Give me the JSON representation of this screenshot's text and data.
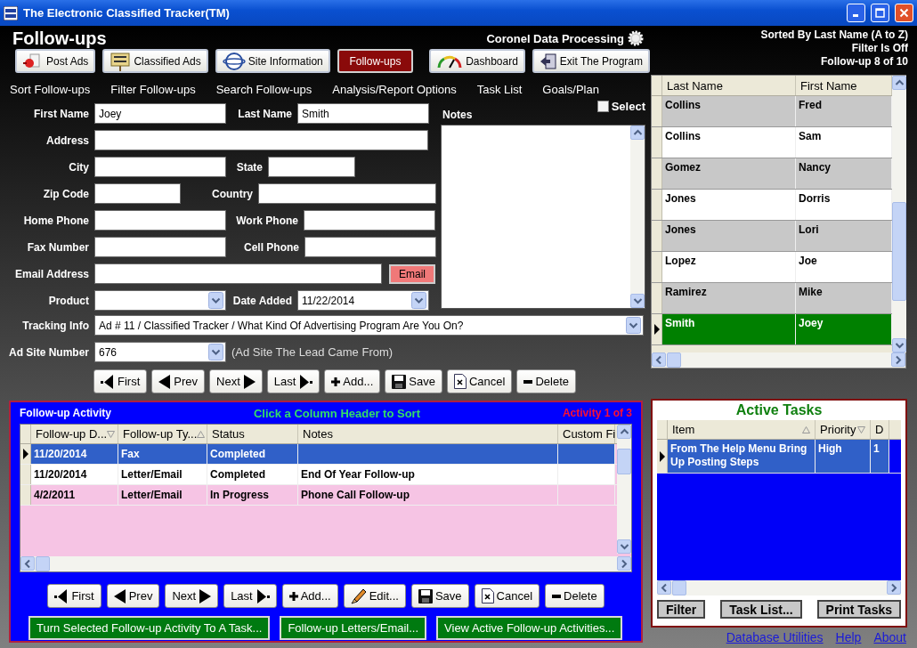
{
  "window": {
    "title": "The Electronic Classified Tracker(TM)"
  },
  "header": {
    "title": "Follow-ups",
    "company": "Coronel Data Processing",
    "status": [
      "Sorted By Last Name (A to Z)",
      "Filter Is Off",
      "Follow-up 8 of 10"
    ]
  },
  "nav_buttons": [
    {
      "label": "Post Ads",
      "kind": "pin",
      "selected": false
    },
    {
      "label": "Classified Ads",
      "kind": "sign",
      "selected": false
    },
    {
      "label": "Site Information",
      "kind": "globe",
      "selected": false
    },
    {
      "label": "Follow-ups",
      "kind": "plain",
      "selected": true
    },
    {
      "label": "Dashboard",
      "kind": "gauge",
      "selected": false
    },
    {
      "label": "Exit The Program",
      "kind": "exit",
      "selected": false
    }
  ],
  "menu": [
    "Sort Follow-ups",
    "Filter Follow-ups",
    "Search Follow-ups",
    "Analysis/Report Options",
    "Task List",
    "Goals/Plan"
  ],
  "form": {
    "rows": [
      [
        {
          "label": "First Name",
          "kind": "text",
          "value": "Joey"
        },
        {
          "label": "Last Name",
          "kind": "text",
          "value": "Smith"
        }
      ],
      [
        {
          "label": "Address",
          "kind": "text"
        }
      ],
      [
        {
          "label": "City",
          "kind": "text"
        },
        {
          "label": "State",
          "kind": "text"
        }
      ],
      [
        {
          "label": "Zip Code",
          "kind": "text"
        },
        {
          "label": "Country",
          "kind": "text"
        }
      ],
      [
        {
          "label": "Home Phone",
          "kind": "text"
        },
        {
          "label": "Work Phone",
          "kind": "text"
        }
      ],
      [
        {
          "label": "Fax Number",
          "kind": "text"
        },
        {
          "label": "Cell Phone",
          "kind": "text"
        }
      ],
      [
        {
          "label": "Email Address",
          "kind": "text"
        },
        {
          "kind": "button",
          "value": "Email"
        }
      ],
      [
        {
          "label": "Product",
          "kind": "dropdown"
        },
        {
          "label": "Date Added",
          "kind": "dropdown",
          "value": "11/22/2014"
        }
      ]
    ],
    "notes": {
      "label": "Notes"
    },
    "select": {
      "label": "Select",
      "checked": false
    },
    "tracking": {
      "label": "Tracking Info",
      "value": "Ad # 11 / Classified Tracker / What Kind Of Advertising Program Are You On?"
    },
    "ad_site": {
      "label": "Ad Site Number",
      "value": "676",
      "hint": "(Ad Site The Lead Came From)"
    }
  },
  "record_buttons": [
    {
      "label": "First",
      "kind": "first"
    },
    {
      "label": "Prev",
      "kind": "prev"
    },
    {
      "label": "Next",
      "kind": "next"
    },
    {
      "label": "Last",
      "kind": "last"
    },
    {
      "label": "Add...",
      "kind": "add"
    },
    {
      "label": "Save",
      "kind": "save"
    },
    {
      "label": "Cancel",
      "kind": "cancel"
    },
    {
      "label": "Delete",
      "kind": "delete"
    }
  ],
  "people": {
    "columns": [
      "Last Name",
      "First Name"
    ],
    "rows": [
      {
        "last": "Collins",
        "first": "Fred",
        "selected": false
      },
      {
        "last": "Collins",
        "first": "Sam",
        "selected": false
      },
      {
        "last": "Gomez",
        "first": "Nancy",
        "selected": false
      },
      {
        "last": "Jones",
        "first": "Dorris",
        "selected": false
      },
      {
        "last": "Jones",
        "first": "Lori",
        "selected": false
      },
      {
        "last": "Lopez",
        "first": "Joe",
        "selected": false
      },
      {
        "last": "Ramirez",
        "first": "Mike",
        "selected": false
      },
      {
        "last": "Smith",
        "first": "Joey",
        "selected": true
      }
    ]
  },
  "activity": {
    "title": "Follow-up Activity",
    "hint": "Click a Column Header to Sort",
    "counter": "Activity 1 of 3",
    "columns": [
      {
        "label": "Follow-up D...",
        "sort_ascending": false
      },
      {
        "label": "Follow-up Ty...",
        "sort_ascending": true
      },
      {
        "label": "Status"
      },
      {
        "label": "Notes"
      },
      {
        "label": "Custom Fi"
      }
    ],
    "rows": [
      {
        "date": "11/20/2014",
        "type": "Fax",
        "status": "Completed",
        "selected": true
      },
      {
        "date": "11/20/2014",
        "type": "Letter/Email",
        "status": "Completed",
        "notes": "End Of Year Follow-up",
        "selected": false
      },
      {
        "date": "4/2/2011",
        "type": "Letter/Email",
        "status": "In Progress",
        "notes": "Phone Call Follow-up",
        "selected": false
      }
    ],
    "buttons": [
      {
        "label": "First",
        "kind": "first"
      },
      {
        "label": "Prev",
        "kind": "prev"
      },
      {
        "label": "Next",
        "kind": "next"
      },
      {
        "label": "Last",
        "kind": "last"
      },
      {
        "label": "Add...",
        "kind": "add"
      },
      {
        "label": "Edit...",
        "kind": "edit"
      },
      {
        "label": "Save",
        "kind": "save"
      },
      {
        "label": "Cancel",
        "kind": "cancel"
      },
      {
        "label": "Delete",
        "kind": "delete"
      }
    ],
    "actions": [
      "Turn Selected Follow-up Activity To A Task...",
      "Follow-up Letters/Email...",
      "View Active Follow-up Activities..."
    ]
  },
  "tasks": {
    "title": "Active Tasks",
    "columns": [
      {
        "label": "Item",
        "sort_ascending": true
      },
      {
        "label": "Priority",
        "sort_ascending": false
      },
      {
        "label": "D"
      }
    ],
    "rows": [
      {
        "item": "From The Help Menu Bring Up Posting Steps",
        "priority": "High",
        "due": "1",
        "selected": true
      }
    ],
    "buttons": [
      "Filter",
      "Task List...",
      "Print Tasks"
    ]
  },
  "links": [
    "Database Utilities",
    "Help",
    "About"
  ]
}
